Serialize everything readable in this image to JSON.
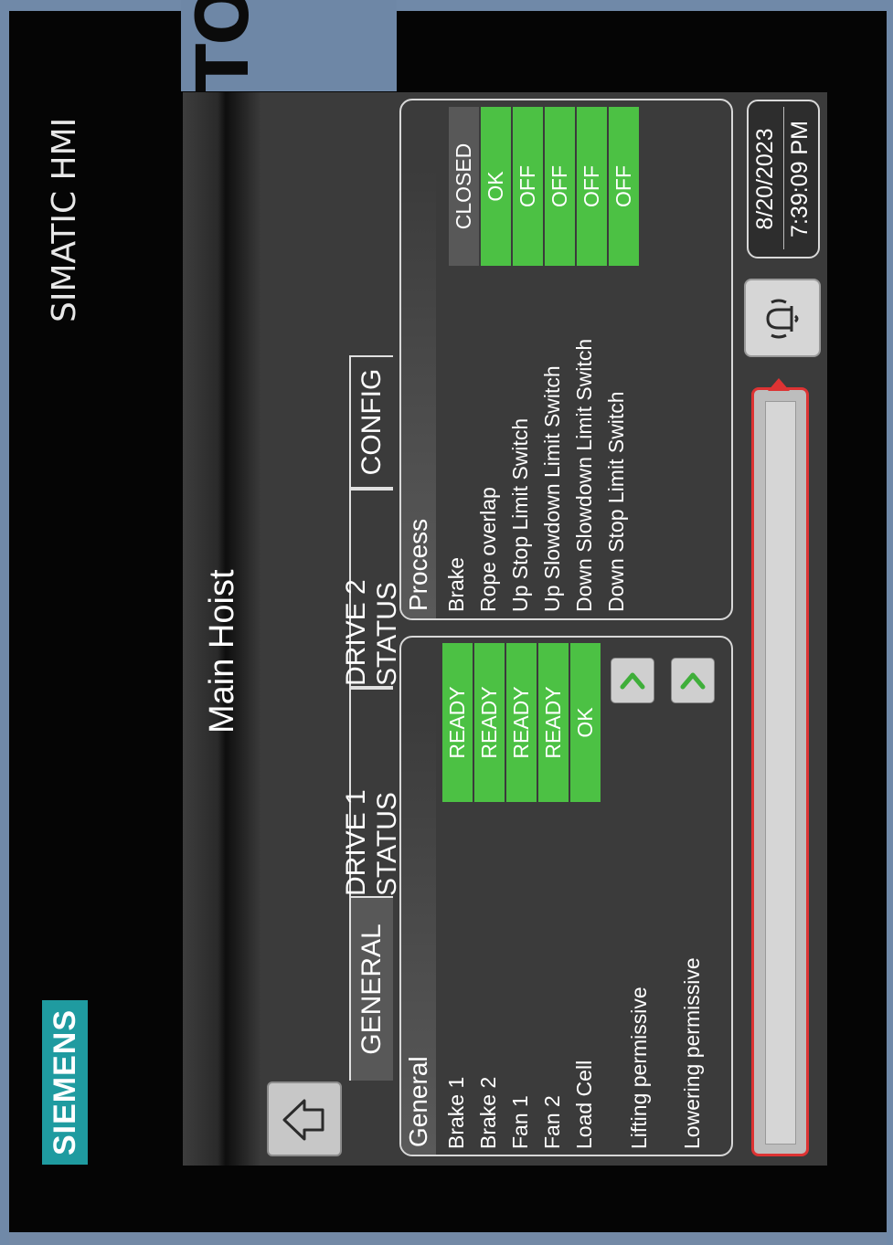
{
  "brand": {
    "logo": "SIEMENS",
    "product": "SIMATIC HMI",
    "panel_type": "TOUCH"
  },
  "header": {
    "title": "Main Hoist"
  },
  "tabs": [
    {
      "label": "GENERAL",
      "active": true
    },
    {
      "label": "DRIVE 1 STATUS",
      "active": false
    },
    {
      "label": "DRIVE 2 STATUS",
      "active": false
    },
    {
      "label": "CONFIG",
      "active": false
    }
  ],
  "general": {
    "heading": "General",
    "rows": [
      {
        "label": "Brake 1",
        "status": "READY"
      },
      {
        "label": "Brake 2",
        "status": "READY"
      },
      {
        "label": "Fan 1",
        "status": "READY"
      },
      {
        "label": "Fan 2",
        "status": "READY"
      },
      {
        "label": "Load Cell",
        "status": "OK"
      }
    ],
    "lifting_label": "Lifting permissive",
    "lowering_label": "Lowering  permissive"
  },
  "process": {
    "heading": "Process",
    "rows": [
      {
        "label": "Brake",
        "status": "CLOSED"
      },
      {
        "label": "Rope overlap",
        "status": "OK"
      },
      {
        "label": "Up Stop Limit Switch",
        "status": "OFF"
      },
      {
        "label": "Up Slowdown Limit Switch",
        "status": "OFF"
      },
      {
        "label": "Down Slowdown Limit Switch",
        "status": "OFF"
      },
      {
        "label": "Down Stop Limit Switch",
        "status": "OFF"
      }
    ]
  },
  "clock": {
    "date": "8/20/2023",
    "time": "7:39:09 PM"
  },
  "colors": {
    "ok_green": "#4cc144",
    "neutral_grey": "#585858",
    "alarm_red": "#dd3333",
    "panel_bg": "#3b3b3b"
  },
  "icons": {
    "home": "home-icon",
    "alarm": "bell-icon",
    "chevron": "chevron-right-icon"
  }
}
